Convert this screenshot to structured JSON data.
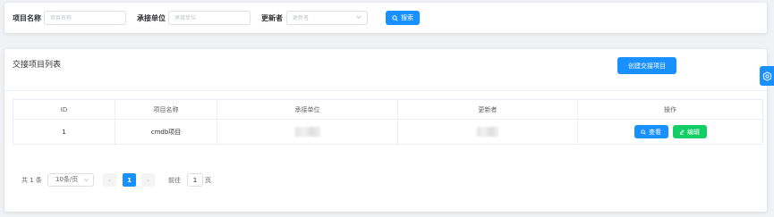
{
  "filters": {
    "project_name_label": "项目名称",
    "project_name_placeholder": "项目名称",
    "contractor_label": "承接单位",
    "contractor_placeholder": "承接单位",
    "updater_label": "更新者",
    "updater_placeholder": "更新者",
    "search_label": "搜索"
  },
  "list": {
    "title": "交接项目列表",
    "create_label": "创建交接项目",
    "columns": [
      "ID",
      "项目名称",
      "承接单位",
      "更新者",
      "操作"
    ],
    "rows": [
      {
        "id": "1",
        "project_name": "cmdb项目",
        "view_label": "查看",
        "edit_label": "编辑"
      }
    ]
  },
  "pagination": {
    "total_text": "共 1 条",
    "page_size": "10条/页",
    "prev": "‹",
    "current_page": "1",
    "next": "›",
    "goto_label": "前往",
    "goto_value": "1",
    "page_suffix": "页"
  },
  "colors": {
    "primary": "#1890ff",
    "success": "#13ce66",
    "background": "#f0f2f5"
  },
  "icons": [
    "search-icon",
    "edit-icon",
    "chevron-down-icon",
    "settings-icon"
  ]
}
